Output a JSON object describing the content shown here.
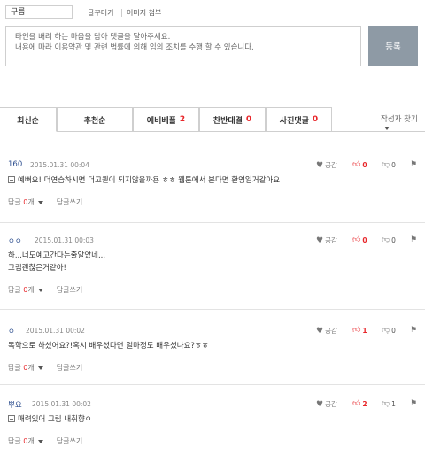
{
  "form": {
    "nickname": "구름",
    "toolbar": {
      "decorate": "글꾸미기",
      "attach_image": "이미지 첨부"
    },
    "placeholder": "타인을 배려 하는 마음을 담아 댓글을 달아주세요.\n내용에 따라 이용약관 및 관련 법률에 의해 임의 조치를 수행 할 수 있습니다.",
    "submit": "등록"
  },
  "tabs": [
    {
      "label": "최신순",
      "count": ""
    },
    {
      "label": "추천순",
      "count": ""
    },
    {
      "label": "예비베플",
      "count": "2"
    },
    {
      "label": "찬반대결",
      "count": "0"
    },
    {
      "label": "사진댓글",
      "count": "0"
    }
  ],
  "sort_label": "작성자 찾기",
  "actions": {
    "like": "공감"
  },
  "footer": {
    "reply_label": "답글",
    "reply_suffix": "개",
    "write_reply": "답글쓰기"
  },
  "colors": {
    "accent_red": "#e8262a",
    "author_blue": "#2e4f8f",
    "submit_bg": "#8e9aa5"
  },
  "comments": [
    {
      "author": "160",
      "date": "2015.01.31 00:04",
      "has_image_icon": true,
      "text": "예뻐요! 더연습하시면 더고퀼이 되지않을까용 ㅎㅎ 웹툰에서 본다면 환영일거같아요",
      "likes": "0",
      "dislikes": "0",
      "reply_count": "0"
    },
    {
      "author": "ㅇㅇ",
      "date": "2015.01.31 00:03",
      "has_image_icon": false,
      "text": "하...너도예고간다는줄알았네...\n그림괜찮은거같아!",
      "likes": "0",
      "dislikes": "0",
      "reply_count": "0"
    },
    {
      "author": "ㅇ",
      "date": "2015.01.31 00:02",
      "has_image_icon": false,
      "text": "독학으로 하셨어요?!혹시 배우셨다면 얼마정도 배우셨나요?ㅎㅎ",
      "likes": "1",
      "dislikes": "0",
      "reply_count": "0"
    },
    {
      "author": "뿌요",
      "date": "2015.01.31 00:02",
      "has_image_icon": true,
      "text": "매력있어 그림 내취향ㅇ",
      "likes": "2",
      "dislikes": "1",
      "reply_count": "0"
    }
  ]
}
